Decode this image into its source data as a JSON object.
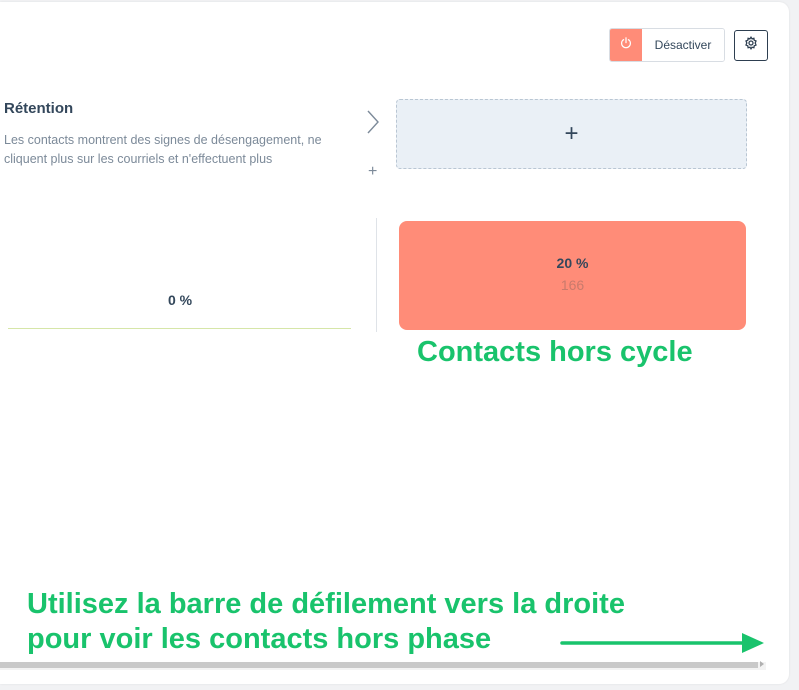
{
  "controls": {
    "deactivate_label": "Désactiver",
    "power_icon": "power-icon",
    "settings_icon": "gear-icon",
    "accent_color": "#ff8c78"
  },
  "stage": {
    "title": "Rétention",
    "description": "Les contacts montrent des signes de désengagement, ne cliquent plus sur les courriels et n'effectuent plus",
    "next_icon": "chevron-right-icon",
    "add_label": "+",
    "add_stage_label": "+",
    "percent": "0 %"
  },
  "out_of_cycle": {
    "percent": "20 %",
    "count": "166",
    "color": "#ff8c78"
  },
  "annotations": {
    "cycle_label": "Contacts hors cycle",
    "scroll_line1": "Utilisez la barre de défilement vers la droite",
    "scroll_line2": "pour voir les contacts hors phase",
    "color": "#19c36c"
  }
}
